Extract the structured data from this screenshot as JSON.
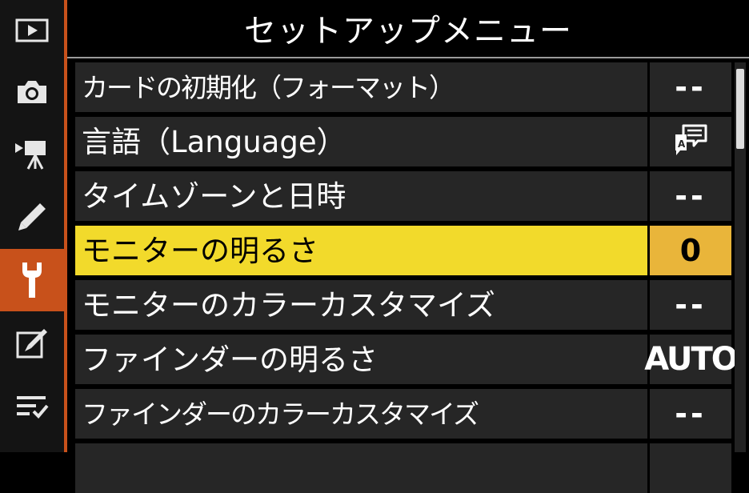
{
  "title": "セットアップメニュー",
  "tabs": [
    {
      "icon": "playback-icon"
    },
    {
      "icon": "camera-icon"
    },
    {
      "icon": "movie-camera-icon"
    },
    {
      "icon": "pencil-icon"
    },
    {
      "icon": "wrench-icon",
      "active": true
    },
    {
      "icon": "retouch-icon"
    },
    {
      "icon": "my-menu-icon"
    }
  ],
  "menu": {
    "items": [
      {
        "label": "カードの初期化（フォーマット）",
        "value": "--"
      },
      {
        "label": "言語（Language）",
        "value_icon": "language-icon"
      },
      {
        "label": "タイムゾーンと日時",
        "value": "--"
      },
      {
        "label": "モニターの明るさ",
        "value": "0",
        "selected": true
      },
      {
        "label": "モニターのカラーカスタマイズ",
        "value": "--"
      },
      {
        "label": "ファインダーの明るさ",
        "value": "AUTO"
      },
      {
        "label": "ファインダーのカラーカスタマイズ",
        "value": "--"
      }
    ]
  },
  "colors": {
    "background": "#000000",
    "row_background": "#262626",
    "selected_row": "#f2da2b",
    "selected_value": "#e9b53a",
    "active_tab": "#c8511b",
    "sidebar": "#141414"
  }
}
